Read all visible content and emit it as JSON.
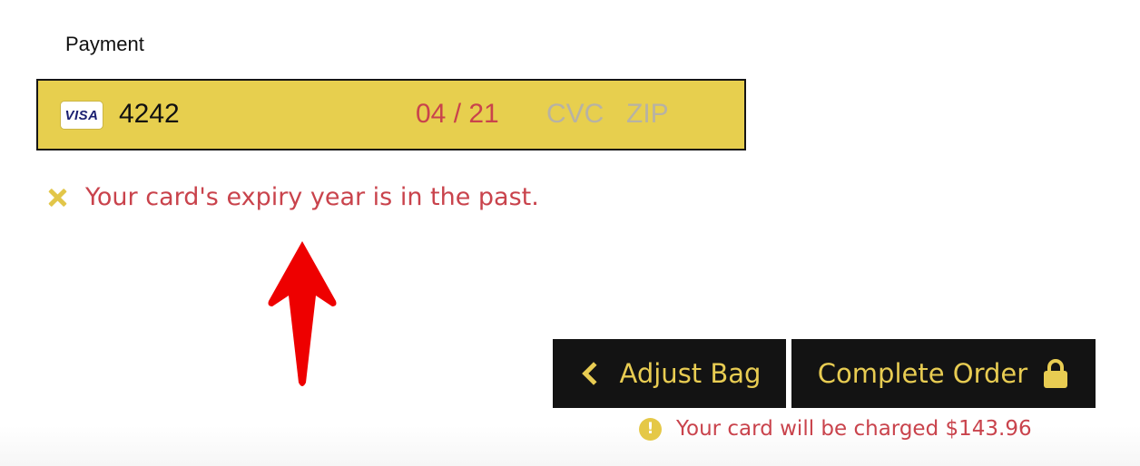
{
  "payment": {
    "label": "Payment",
    "card": {
      "brand": "VISA",
      "number": "4242",
      "expiry": "04 / 21",
      "cvc_placeholder": "CVC",
      "zip_placeholder": "ZIP"
    },
    "error_message": "Your card's expiry year is in the past."
  },
  "actions": {
    "adjust_bag_label": "Adjust Bag",
    "complete_order_label": "Complete Order"
  },
  "notice": {
    "warning_glyph": "!",
    "charge_text": "Your card will be charged $143.96"
  },
  "icons": {
    "error": "x-icon",
    "back": "chevron-left-icon",
    "lock": "lock-icon",
    "warning": "exclamation-circle-icon",
    "annotation": "red-arrow-up-icon"
  },
  "colors": {
    "field_background": "#e7cf4e",
    "button_background": "#131313",
    "accent_yellow": "#e8cc52",
    "error_red": "#c9434c",
    "arrow_red": "#ee0000"
  }
}
